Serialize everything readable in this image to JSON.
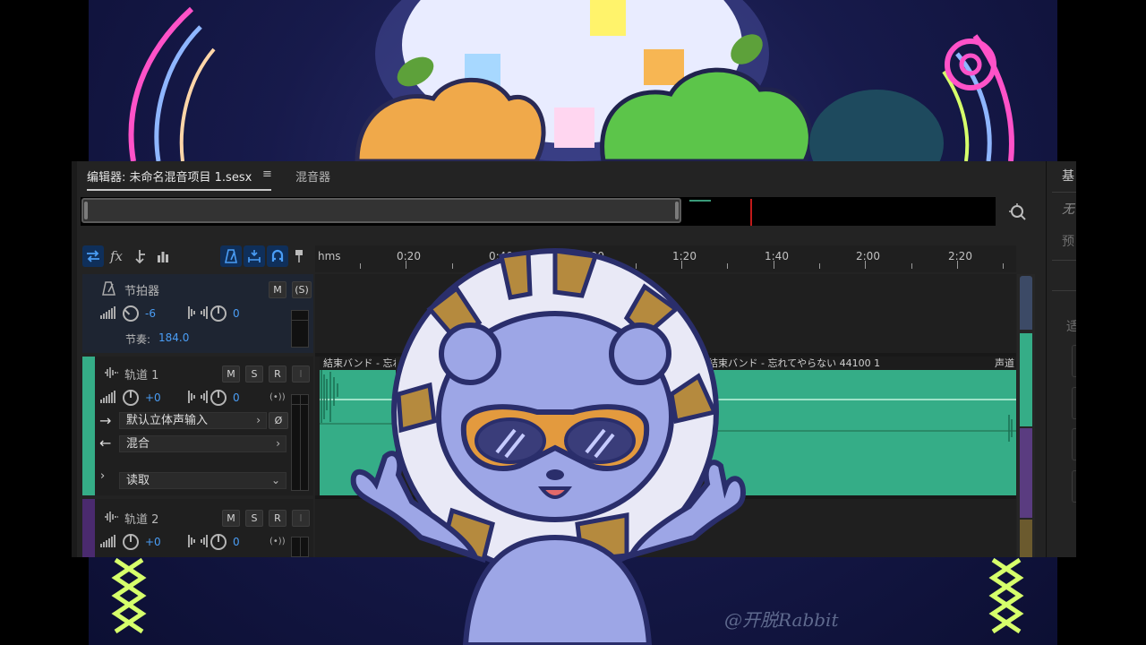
{
  "editor": {
    "tab_active": "编辑器: 未命名混音项目 1.sesx",
    "tab_menu_icon": "≡",
    "tab_mixer": "混音器"
  },
  "right_panel": {
    "title": "基",
    "item1": "无",
    "item2": "预",
    "item3": "适"
  },
  "ruler": {
    "labels": [
      "hms",
      "0:20",
      "0:40",
      "1:00",
      "1:20",
      "1:40",
      "2:00",
      "2:20"
    ]
  },
  "metronome": {
    "name": "节拍器",
    "mute": "M",
    "solo": "(S)",
    "volume": "-6",
    "pan": "0",
    "tempo_label": "节奏:",
    "tempo_value": "184.0"
  },
  "track1": {
    "name": "轨道 1",
    "mute": "M",
    "solo": "S",
    "record": "R",
    "input_mon": "I",
    "volume": "+0",
    "pan": "0",
    "input": "默认立体声输入",
    "output": "混合",
    "automation": "读取",
    "color": "#35ad87",
    "clip1_label": "結束バンド - 忘れて",
    "clip2_label": "結束バンド - 忘れてやらない 44100 1",
    "clip2_suffix": "声道"
  },
  "track2": {
    "name": "轨道 2",
    "mute": "M",
    "solo": "S",
    "record": "R",
    "input_mon": "I",
    "volume": "+0",
    "pan": "0",
    "color": "#4a2a6e"
  },
  "watermark": "@开脱Rabbit"
}
